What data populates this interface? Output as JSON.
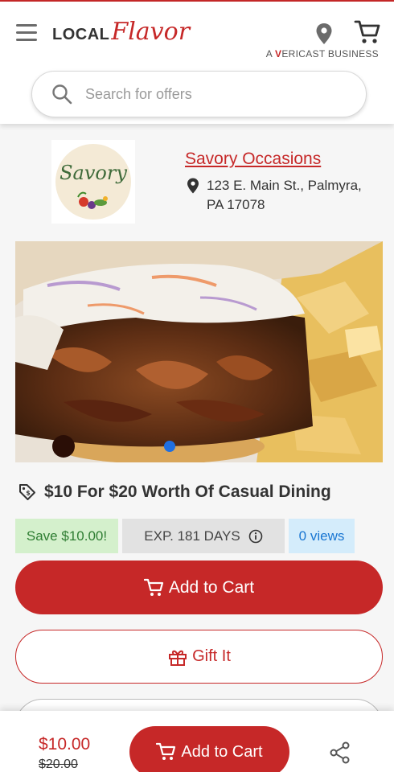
{
  "header": {
    "logo_local": "LOCAL",
    "logo_flavor": "Flavor",
    "tagline_prefix": "A ",
    "tagline_brand_v": "V",
    "tagline_brand_rest": "ERICAST",
    "tagline_suffix": " BUSINESS",
    "menu_icon": "hamburger-icon",
    "location_icon": "map-pin-icon",
    "cart_icon": "shopping-cart-icon"
  },
  "search": {
    "placeholder": "Search for offers",
    "value": ""
  },
  "merchant": {
    "name": "Savory Occasions",
    "address": "123 E. Main St., Palmyra, PA 17078",
    "logo_text": "Savory"
  },
  "carousel": {
    "active_index": 0,
    "slide_count": 1
  },
  "deal": {
    "title": "$10 For $20 Worth Of Casual Dining",
    "save_label": "Save $10.00!",
    "expiry_label": "EXP. 181 DAYS",
    "views_label": "0 views",
    "add_to_cart_label": "Add to Cart",
    "gift_label": "Gift It"
  },
  "bottom_bar": {
    "price": "$10.00",
    "original_price": "$20.00",
    "add_to_cart_label": "Add to Cart",
    "share_icon": "share-icon"
  },
  "colors": {
    "brand_red": "#c62828",
    "save_green_bg": "#d4f0cc",
    "views_blue_bg": "#d4ecfb",
    "carousel_dot": "#1f6fe0"
  }
}
